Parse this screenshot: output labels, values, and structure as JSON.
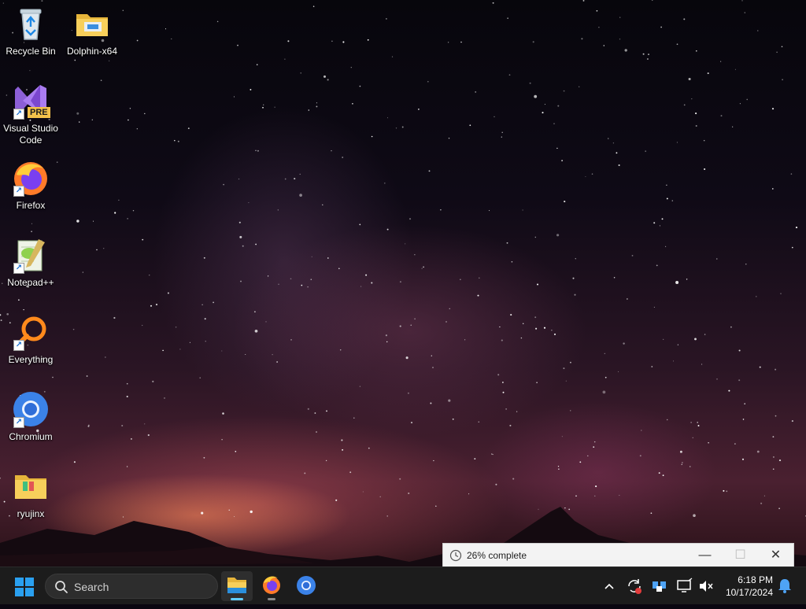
{
  "desktop": {
    "icons": [
      {
        "label": "Recycle Bin"
      },
      {
        "label": "Dolphin-x64"
      },
      {
        "label": "Visual Studio Code",
        "badge": "PRE"
      },
      {
        "label": "Firefox"
      },
      {
        "label": "Notepad++"
      },
      {
        "label": "Everything"
      },
      {
        "label": "Chromium"
      },
      {
        "label": "ryujinx"
      }
    ]
  },
  "progress_window": {
    "text": "26% complete",
    "progress": 0.26,
    "minimize": "—",
    "maximize": "☐",
    "close": "✕"
  },
  "taskbar": {
    "search_label": "Search",
    "apps": [
      "file-explorer",
      "firefox",
      "chromium"
    ],
    "tray": {
      "time": "6:18 PM",
      "date": "10/17/2024"
    }
  },
  "colors": {
    "taskbar_bg": "#1c1c1c",
    "accent": "#60cdff",
    "windows_blue": "#2aa0f0"
  }
}
